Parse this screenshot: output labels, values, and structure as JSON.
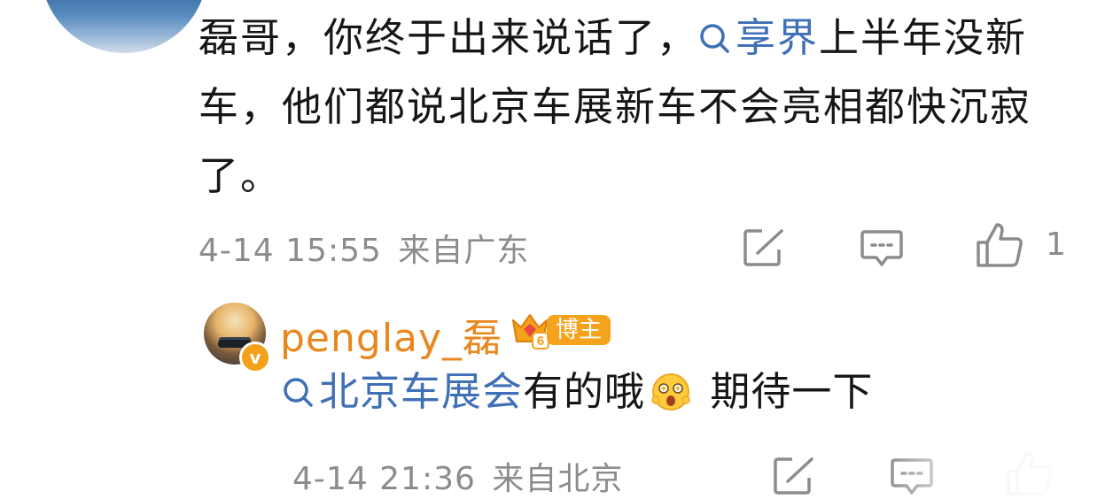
{
  "comment": {
    "text_part1": "磊哥，你终于出来说话了，",
    "topic": "享界",
    "text_part2": "上半年没新车，他们都说北京车展新车不会亮相都快沉寂了。",
    "time": "4-14 15:55",
    "location": "来自广东",
    "like_count": "1"
  },
  "reply": {
    "username": "penglay_磊",
    "badge_label": "博主",
    "badge_level": "6",
    "topic": "北京车展会",
    "text_part1": "有的哦",
    "text_part2": " 期待一下",
    "time": "4-14 21:36",
    "location": "来自北京"
  },
  "colors": {
    "topic_blue": "#3f6fb5",
    "username_orange": "#e9871f",
    "badge_orange": "#f5a21c",
    "meta_gray": "#8c8c8c"
  }
}
